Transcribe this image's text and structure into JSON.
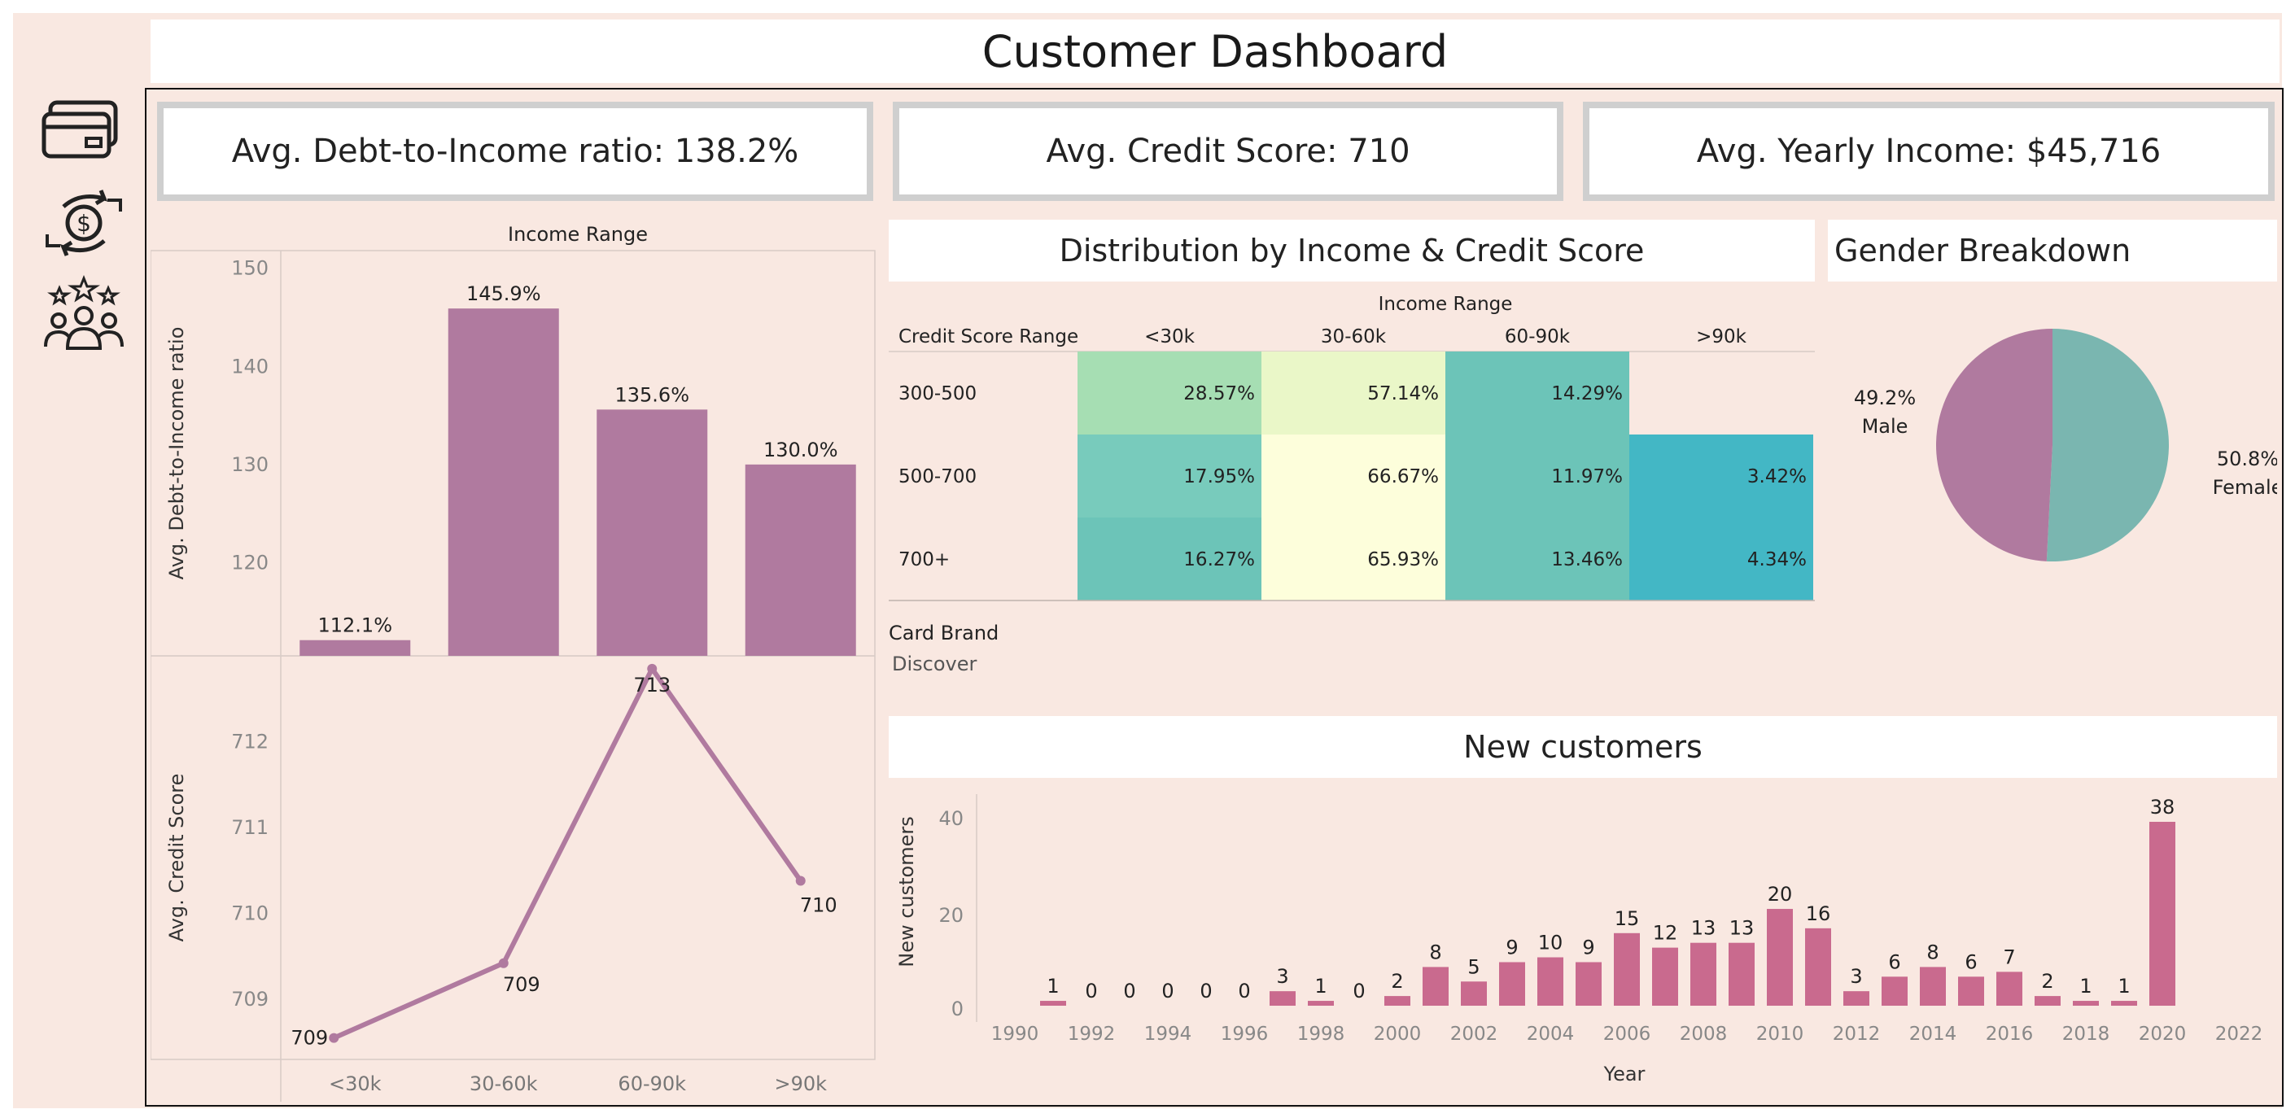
{
  "header": {
    "title": "Customer Dashboard"
  },
  "nav": {
    "icons": [
      "credit-cards-icon",
      "money-exchange-icon",
      "customers-rating-icon"
    ]
  },
  "kpis": [
    {
      "label": "Avg. Debt-to-Income ratio: 138.2%"
    },
    {
      "label": "Avg. Credit Score: 710"
    },
    {
      "label": "Avg. Yearly Income: $45,716"
    }
  ],
  "panels": {
    "distribution_title": "Distribution by Income & Credit Score",
    "gender_title": "Gender Breakdown",
    "new_customers_title": "New customers",
    "filter_label": "Card Brand",
    "filter_value": "Discover"
  },
  "colors": {
    "bar": "#b07a9f",
    "line": "#b07a9f",
    "new_bar": "#c96a8e",
    "female": "#7ab6b0",
    "male": "#b07a9f"
  },
  "chart_data": [
    {
      "id": "dti",
      "type": "bar",
      "title": "Income Range",
      "ylabel": "Avg. Debt-to-Income ratio",
      "categories": [
        "<30k",
        "30-60k",
        "60-90k",
        ">90k"
      ],
      "values": [
        112.1,
        145.9,
        135.6,
        130.0
      ],
      "labels": [
        "112.1%",
        "145.9%",
        "135.6%",
        "130.0%"
      ],
      "yticks": [
        120,
        130,
        140,
        150
      ],
      "ylim": [
        110.5,
        151.8
      ]
    },
    {
      "id": "credit",
      "type": "line",
      "ylabel": "Avg. Credit Score",
      "categories": [
        "<30k",
        "30-60k",
        "60-90k",
        ">90k"
      ],
      "values": [
        708.55,
        709.42,
        712.85,
        710.38
      ],
      "labels": [
        "709",
        "709",
        "713",
        "710"
      ],
      "yticks": [
        709,
        710,
        711,
        712
      ],
      "ylim": [
        708.3,
        713.0
      ]
    },
    {
      "id": "heatmap",
      "type": "heatmap",
      "col_header": "Income Range",
      "row_header": "Credit Score Range",
      "columns": [
        "<30k",
        "30-60k",
        "60-90k",
        ">90k"
      ],
      "rows": [
        "300-500",
        "500-700",
        "700+"
      ],
      "cells": [
        [
          "28.57%",
          "57.14%",
          "14.29%",
          ""
        ],
        [
          "17.95%",
          "66.67%",
          "11.97%",
          "3.42%"
        ],
        [
          "16.27%",
          "65.93%",
          "13.46%",
          "4.34%"
        ]
      ],
      "cell_colors": [
        [
          "#a6deb3",
          "#eaf7c8",
          "#6cc4b8",
          null
        ],
        [
          "#78cbbc",
          "#fdfedb",
          "#6cc4b8",
          "#43b7c5"
        ],
        [
          "#6cc4b8",
          "#fdfedb",
          "#6cc4b8",
          "#43b7c5"
        ]
      ]
    },
    {
      "id": "gender",
      "type": "pie",
      "slices": [
        {
          "name": "Female",
          "value": 50.8,
          "label": "50.8%"
        },
        {
          "name": "Male",
          "value": 49.2,
          "label": "49.2%"
        }
      ]
    },
    {
      "id": "new_customers",
      "type": "bar",
      "xlabel": "Year",
      "ylabel": "New customers",
      "years": [
        1991,
        1992,
        1993,
        1994,
        1995,
        1996,
        1997,
        1998,
        1999,
        2000,
        2001,
        2002,
        2003,
        2004,
        2005,
        2006,
        2007,
        2008,
        2009,
        2010,
        2011,
        2012,
        2013,
        2014,
        2015,
        2016,
        2017,
        2018,
        2019,
        2020
      ],
      "values": [
        1,
        0,
        0,
        0,
        0,
        0,
        3,
        1,
        0,
        2,
        8,
        5,
        9,
        10,
        9,
        15,
        12,
        13,
        13,
        20,
        16,
        3,
        6,
        8,
        6,
        7,
        2,
        1,
        1,
        38
      ],
      "xticks": [
        "1990",
        "1992",
        "1994",
        "1996",
        "1998",
        "2000",
        "2002",
        "2004",
        "2006",
        "2008",
        "2010",
        "2012",
        "2014",
        "2016",
        "2018",
        "2020",
        "2022"
      ],
      "yticks": [
        0,
        20,
        40
      ],
      "xlim": [
        1989,
        2023
      ]
    }
  ]
}
